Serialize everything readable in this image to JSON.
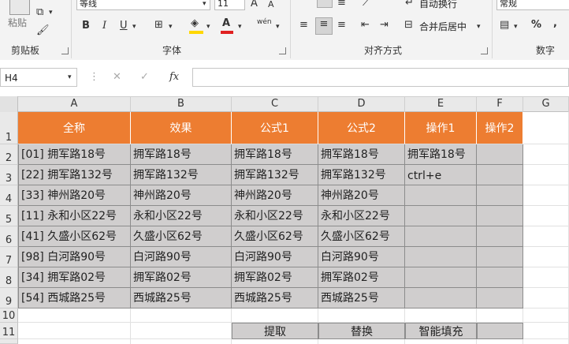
{
  "ribbon": {
    "clipboard": {
      "paste_label": "粘贴",
      "group_label": "剪贴板"
    },
    "font": {
      "font_name": "等线",
      "font_size": "11",
      "group_label": "字体",
      "bold": "B",
      "italic": "I",
      "underline": "U",
      "grow": "A",
      "shrink": "A",
      "phonetic": "wén"
    },
    "alignment": {
      "wrap_label": "自动换行",
      "merge_label": "合并后居中",
      "group_label": "对齐方式"
    },
    "number": {
      "format_value": "常规",
      "group_label": "数字",
      "percent": "%"
    }
  },
  "formula_bar": {
    "name_box": "H4",
    "fx": "fx",
    "cancel": "✕",
    "enter": "✓"
  },
  "columns": [
    "A",
    "B",
    "C",
    "D",
    "E",
    "F",
    "G"
  ],
  "rows": [
    "1",
    "2",
    "3",
    "4",
    "5",
    "6",
    "7",
    "8",
    "9",
    "10",
    "11"
  ],
  "headers": [
    "全称",
    "效果",
    "公式1",
    "公式2",
    "操作1",
    "操作2"
  ],
  "data_rows": [
    [
      "[01] 拥军路18号",
      "拥军路18号",
      "拥军路18号",
      "拥军路18号",
      "拥军路18号",
      ""
    ],
    [
      "[22] 拥军路132号",
      "拥军路132号",
      "拥军路132号",
      "拥军路132号",
      "ctrl+e",
      ""
    ],
    [
      "[33] 神州路20号",
      "神州路20号",
      "神州路20号",
      "神州路20号",
      "",
      ""
    ],
    [
      "[11] 永和小区22号",
      "永和小区22号",
      "永和小区22号",
      "永和小区22号",
      "",
      ""
    ],
    [
      "[41] 久盛小区62号",
      "久盛小区62号",
      "久盛小区62号",
      "久盛小区62号",
      "",
      ""
    ],
    [
      "[98] 白河路90号",
      "白河路90号",
      "白河路90号",
      "白河路90号",
      "",
      ""
    ],
    [
      "[34] 拥军路02号",
      "拥军路02号",
      "拥军路02号",
      "拥军路02号",
      "",
      ""
    ],
    [
      "[54] 西城路25号",
      "西城路25号",
      "西城路25号",
      "西城路25号",
      "",
      ""
    ]
  ],
  "row11": [
    "提取",
    "替换",
    "智能填充",
    ""
  ],
  "colors": {
    "header_orange": "#ed7d31",
    "data_gray": "#d0cece",
    "font_red": "#e02020",
    "fill_yellow": "#ffd700"
  }
}
